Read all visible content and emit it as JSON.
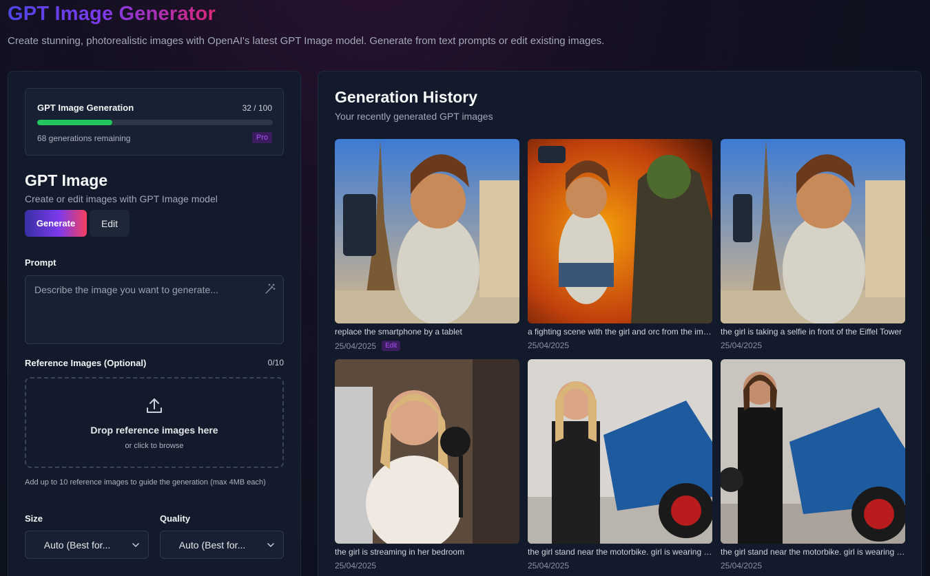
{
  "header": {
    "title": "GPT Image Generator",
    "subtitle": "Create stunning, photorealistic images with OpenAI's latest GPT Image model. Generate from text prompts or edit existing images."
  },
  "usage": {
    "title": "GPT Image Generation",
    "count": "32 / 100",
    "progress": 0.32,
    "remaining": "68 generations remaining",
    "plan": "Pro",
    "bar_color": "#22c55e"
  },
  "tool": {
    "title": "GPT Image",
    "description": "Create or edit images with GPT Image model",
    "generate_label": "Generate",
    "edit_label": "Edit"
  },
  "prompt": {
    "label": "Prompt",
    "placeholder": "Describe the image you want to generate..."
  },
  "reference": {
    "label": "Reference Images (Optional)",
    "count": "0/10",
    "drop_title": "Drop reference images here",
    "drop_sub": "or click to browse",
    "help": "Add up to 10 reference images to guide the generation (max 4MB each)"
  },
  "size": {
    "label": "Size",
    "value": "Auto (Best for..."
  },
  "quality": {
    "label": "Quality",
    "value": "Auto (Best for..."
  },
  "history": {
    "title": "Generation History",
    "subtitle": "Your recently generated GPT images",
    "items": [
      {
        "caption": "replace the smartphone by a tablet",
        "date": "25/04/2025",
        "badge": "Edit"
      },
      {
        "caption": "a fighting scene with the girl and orc from the image",
        "date": "25/04/2025"
      },
      {
        "caption": "the girl is taking a selfie in front of the Eiffel Tower",
        "date": "25/04/2025"
      },
      {
        "caption": "the girl is streaming in her bedroom",
        "date": "25/04/2025"
      },
      {
        "caption": "the girl stand near the motorbike. girl is wearing a leather jacket",
        "date": "25/04/2025"
      },
      {
        "caption": "the girl stand near the motorbike. girl is wearing a leather jacket",
        "date": "25/04/2025"
      }
    ]
  },
  "colors": {
    "accent_gradient_start": "#4f46e5",
    "accent_gradient_end": "#db2777",
    "panel_bg": "#121a2b"
  }
}
